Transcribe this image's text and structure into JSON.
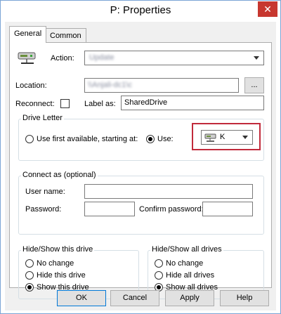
{
  "window": {
    "title": "P: Properties",
    "close_glyph": "✕"
  },
  "tabs": [
    {
      "label": "General",
      "active": true
    },
    {
      "label": "Common",
      "active": false
    }
  ],
  "action": {
    "label": "Action:",
    "value": "Update",
    "icon": "drive-icon"
  },
  "location": {
    "label": "Location:",
    "value": "\\\\Anjali-dc1\\c",
    "browse_label": "..."
  },
  "reconnect": {
    "label": "Reconnect:",
    "checked": false
  },
  "label_as": {
    "label": "Label as:",
    "value": "SharedDrive"
  },
  "drive_letter": {
    "group_title": "Drive Letter",
    "option_first": "Use first available, starting at:",
    "option_use": "Use:",
    "selected": "use",
    "letter": "K",
    "letter_icon": "drive-icon"
  },
  "connect_as": {
    "group_title": "Connect as (optional)",
    "username_label": "User name:",
    "username_value": "",
    "password_label": "Password:",
    "password_value": "",
    "confirm_label": "Confirm password:",
    "confirm_value": ""
  },
  "hide_show_drive": {
    "group_title": "Hide/Show this drive",
    "options": [
      "No change",
      "Hide this drive",
      "Show this drive"
    ],
    "selected_index": 2
  },
  "hide_show_all": {
    "group_title": "Hide/Show all drives",
    "options": [
      "No change",
      "Hide all drives",
      "Show all drives"
    ],
    "selected_index": 2
  },
  "buttons": {
    "ok": "OK",
    "cancel": "Cancel",
    "apply": "Apply",
    "help": "Help"
  },
  "colors": {
    "highlight": "#c12a3b",
    "close": "#c7372f",
    "accent": "#0078d7"
  }
}
